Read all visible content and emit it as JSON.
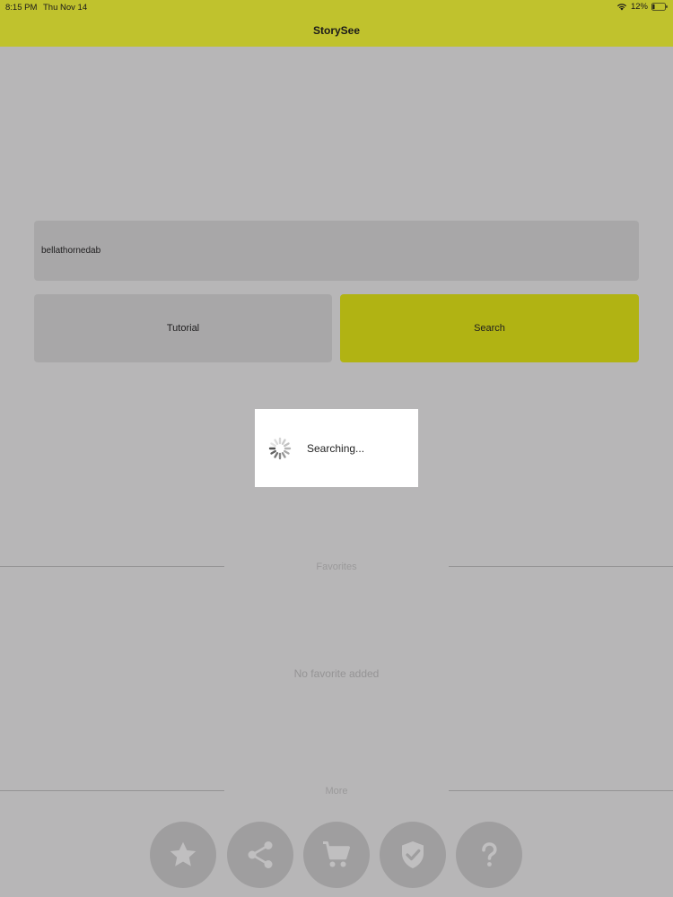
{
  "status_bar": {
    "time": "8:15 PM",
    "date": "Thu Nov 14",
    "battery": "12%"
  },
  "nav": {
    "title": "StorySee"
  },
  "search": {
    "value": "bellathornedab"
  },
  "buttons": {
    "tutorial": "Tutorial",
    "search": "Search"
  },
  "hud": {
    "text": "Searching..."
  },
  "favorites": {
    "label": "Favorites",
    "empty_text": "No favorite added"
  },
  "more": {
    "label": "More",
    "actions": [
      {
        "icon": "star-icon"
      },
      {
        "icon": "share-icon"
      },
      {
        "icon": "cart-icon"
      },
      {
        "icon": "shield-check-icon"
      },
      {
        "icon": "question-icon"
      }
    ]
  },
  "colors": {
    "accent": "#e6e92a",
    "search_button": "#e9ee00",
    "field_bg": "#dcdcdc"
  }
}
